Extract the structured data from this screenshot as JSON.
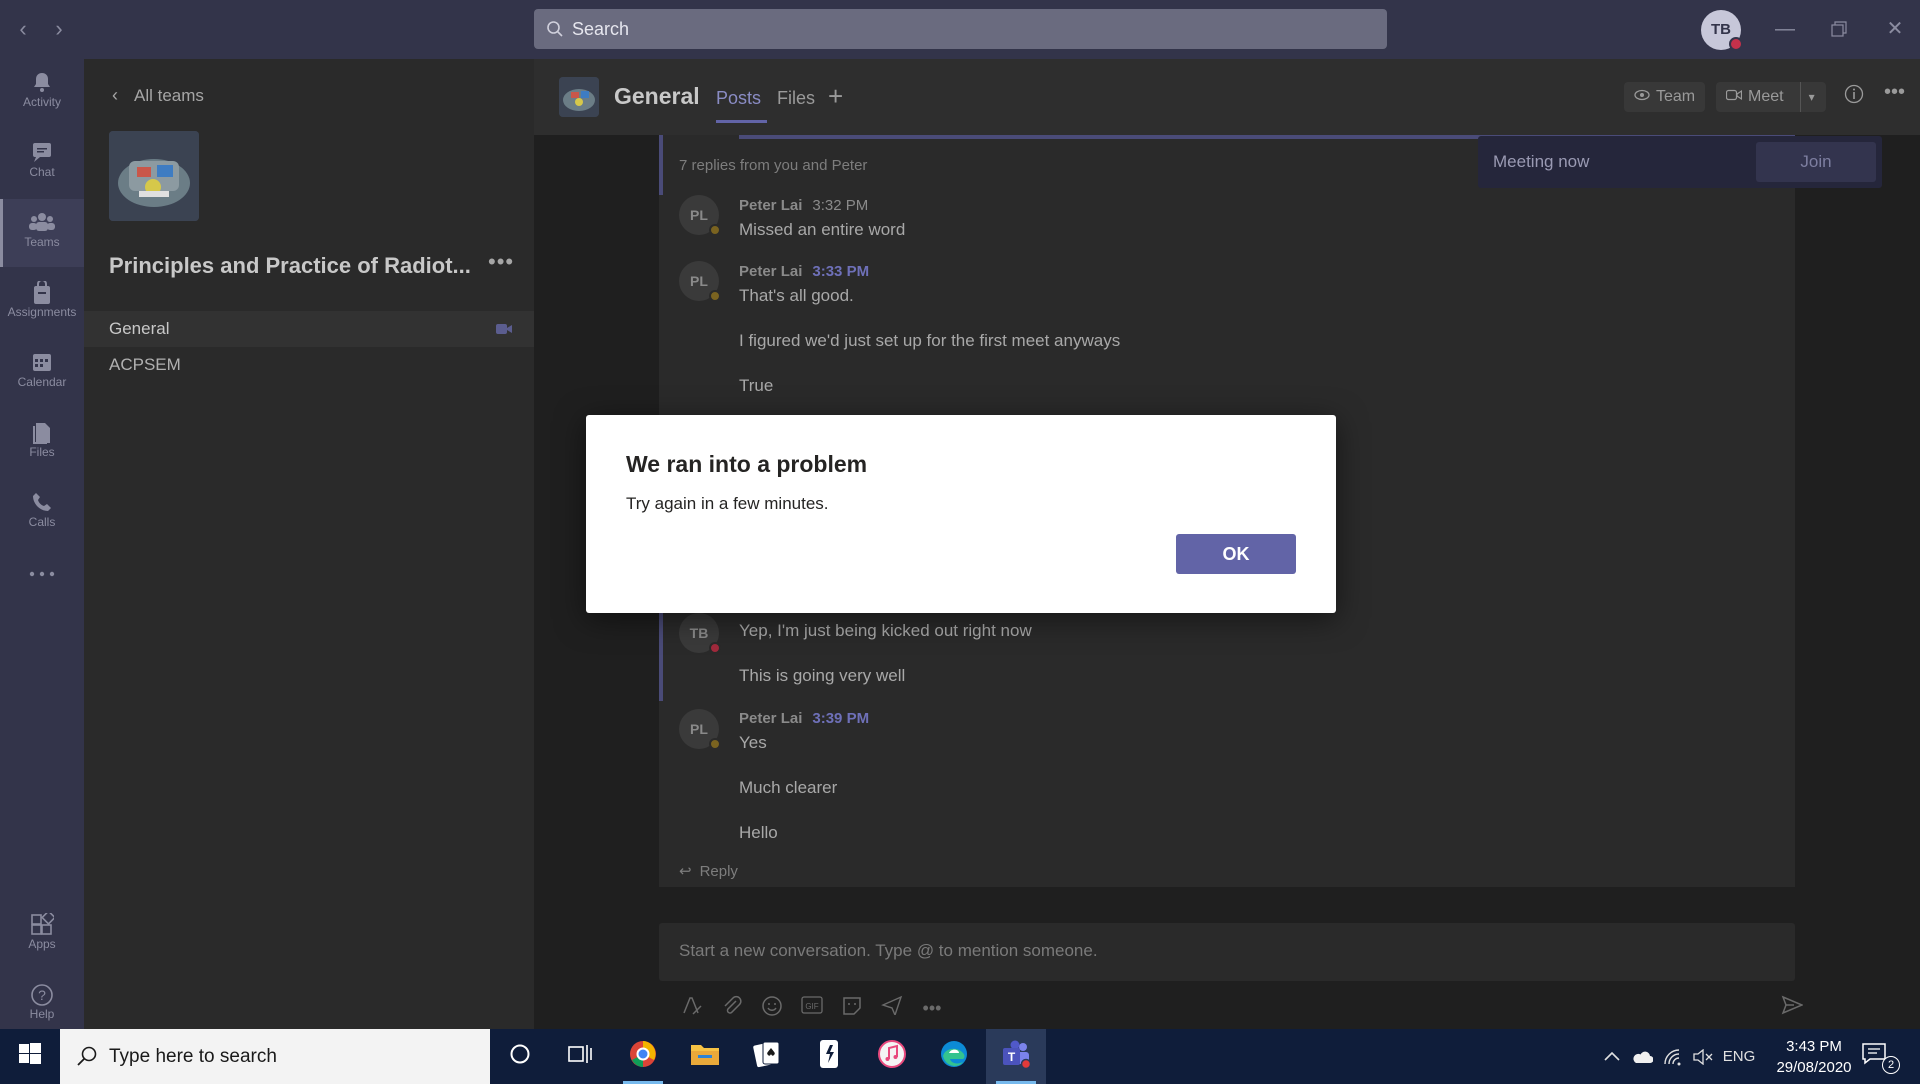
{
  "search": {
    "placeholder": "Search"
  },
  "user": {
    "initials": "TB"
  },
  "rail": {
    "items": [
      {
        "label": "Activity",
        "icon": "bell-icon"
      },
      {
        "label": "Chat",
        "icon": "chat-icon"
      },
      {
        "label": "Teams",
        "icon": "teams-icon"
      },
      {
        "label": "Assignments",
        "icon": "assignments-icon"
      },
      {
        "label": "Calendar",
        "icon": "calendar-icon"
      },
      {
        "label": "Files",
        "icon": "files-icon"
      },
      {
        "label": "Calls",
        "icon": "phone-icon"
      },
      {
        "label": "",
        "icon": "more-icon"
      }
    ],
    "apps_label": "Apps",
    "help_label": "Help"
  },
  "pane": {
    "all_teams": "All teams",
    "team_name": "Principles and Practice of Radiot...",
    "channels": [
      {
        "label": "General"
      },
      {
        "label": "ACPSEM"
      }
    ]
  },
  "channel": {
    "title": "General",
    "tabs": [
      {
        "label": "Posts"
      },
      {
        "label": "Files"
      }
    ],
    "team_button": "Team",
    "meet_button": "Meet"
  },
  "meeting": {
    "text": "Meeting now",
    "join_label": "Join"
  },
  "thread": {
    "replies_info": "7 replies from you and Peter",
    "messages": [
      {
        "initials": "PL",
        "author": "Peter Lai",
        "time": "3:32 PM",
        "lines": [
          "Missed an entire word"
        ]
      },
      {
        "initials": "PL",
        "author": "Peter Lai",
        "time": "3:33 PM",
        "lines": [
          "That's all good.",
          "I figured we'd just set up for the first meet anyways",
          "True"
        ]
      },
      {
        "initials": "TB",
        "author": "",
        "time": "",
        "lines": [
          "Yep, I'm just being kicked out right now",
          "This is going very well"
        ]
      },
      {
        "initials": "PL",
        "author": "Peter Lai",
        "time": "3:39 PM",
        "lines": [
          "Yes",
          "Much clearer",
          "Hello"
        ]
      }
    ],
    "reply_label": "Reply"
  },
  "compose": {
    "placeholder": "Start a new conversation. Type @ to mention someone."
  },
  "dialog": {
    "title": "We ran into a problem",
    "message": "Try again in a few minutes.",
    "ok_label": "OK"
  },
  "taskbar": {
    "search_placeholder": "Type here to search",
    "language": "ENG",
    "time": "3:43 PM",
    "date": "29/08/2020",
    "notification_count": "2"
  },
  "colors": {
    "accent": "#6264a7",
    "title_bar": "#33344a",
    "taskbar": "#0f1d3a"
  }
}
